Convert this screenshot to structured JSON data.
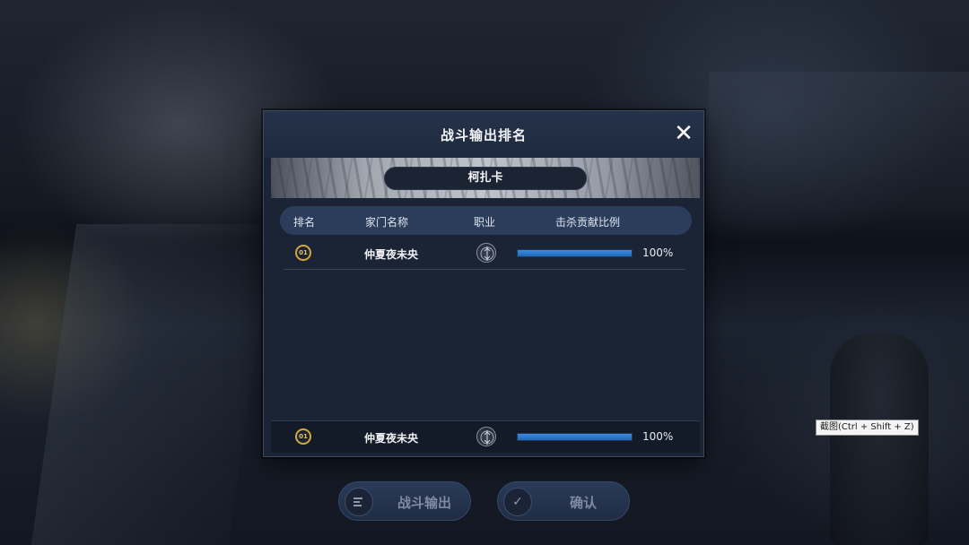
{
  "dialog": {
    "title": "战斗输出排名",
    "close_symbol": "✕",
    "boss_name": "柯扎卡"
  },
  "table": {
    "headers": [
      "排名",
      "家门名称",
      "职业",
      "击杀贡献比例"
    ],
    "rows": [
      {
        "rank": "01",
        "family_name": "仲夏夜未央",
        "class_icon": "class-emblem-icon",
        "contribution": 1.0,
        "percent_text": "100%"
      }
    ]
  },
  "my_row": {
    "rank": "01",
    "family_name": "仲夏夜未央",
    "class_icon": "class-emblem-icon",
    "contribution": 1.0,
    "percent_text": "100%"
  },
  "bottom_buttons": {
    "battle_output": {
      "label": "战斗输出",
      "icon": "list-icon"
    },
    "confirm": {
      "label": "确认",
      "icon": "check-icon"
    }
  },
  "tooltip": "截图(Ctrl + Shift + Z)",
  "colors": {
    "accent_blue": "#2f7fd6",
    "rank_gold": "#d2a73e",
    "panel": "#1b2434"
  }
}
